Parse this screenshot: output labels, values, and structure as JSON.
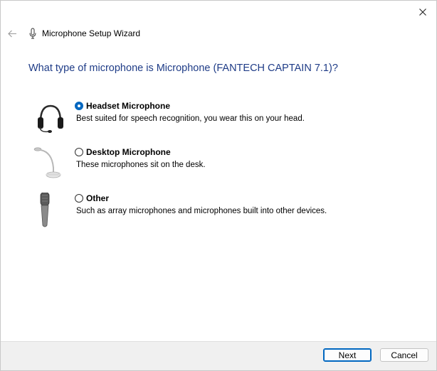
{
  "window": {
    "title": "Microphone Setup Wizard"
  },
  "question": "What type of microphone is Microphone (FANTECH CAPTAIN 7.1)?",
  "options": [
    {
      "label": "Headset Microphone",
      "description": "Best suited for speech recognition, you wear this on your head.",
      "selected": true,
      "icon": "headset-icon"
    },
    {
      "label": "Desktop Microphone",
      "description": "These microphones sit on the desk.",
      "selected": false,
      "icon": "desktop-microphone-icon"
    },
    {
      "label": "Other",
      "description": "Such as array microphones and microphones built into other devices.",
      "selected": false,
      "icon": "handheld-microphone-icon"
    }
  ],
  "footer": {
    "next_label": "Next",
    "cancel_label": "Cancel"
  },
  "colors": {
    "question_text": "#1f3c87",
    "accent": "#0067c0",
    "footer_bg": "#f0f0f0"
  }
}
